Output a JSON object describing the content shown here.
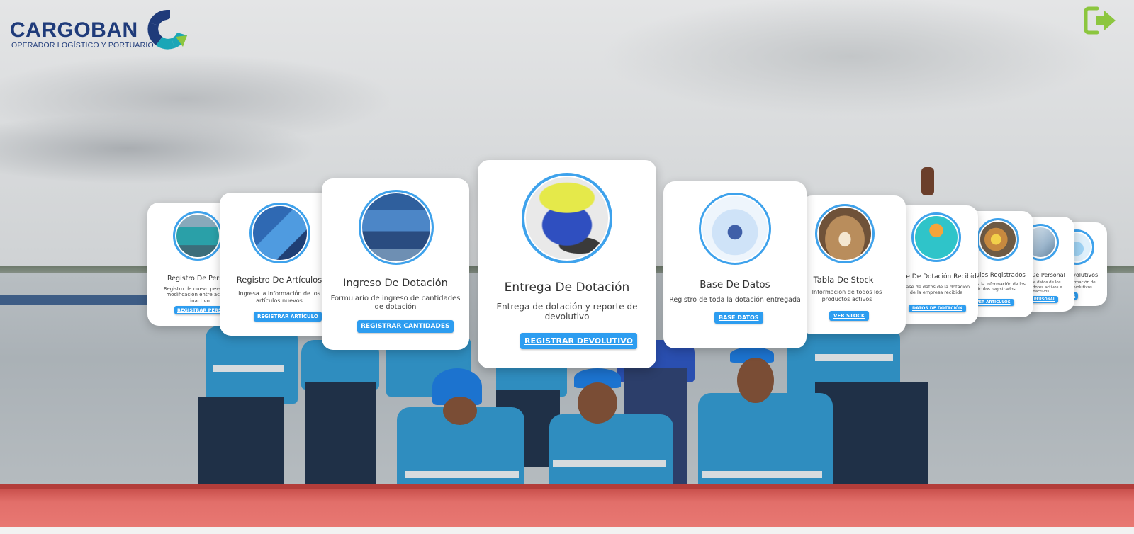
{
  "brand": {
    "name": "CARGOBAN",
    "tagline": "OPERADOR LOGÍSTICO Y PORTUARIO",
    "colors": {
      "navy": "#1f3b7a",
      "teal": "#1aa6b7",
      "blue": "#2d9df0",
      "green": "#8cc63f"
    }
  },
  "header": {
    "logout_icon": "logout-icon"
  },
  "cards": {
    "registro_personal": {
      "title": "Registro De Personal",
      "description": "Registro de nuevo personal y modificación entre activo e inactivo",
      "button": "REGISTRAR PERSONAL",
      "icon": "workers-photo"
    },
    "registro_articulos": {
      "title": "Registro De Artículos",
      "description": "Ingresa la información de los artículos nuevos",
      "button": "REGISTRAR ARTÍCULO",
      "icon": "warehouse-shelves-photo"
    },
    "ingreso_dotacion": {
      "title": "Ingreso De Dotación",
      "description": "Formulario de ingreso de cantidades de dotación",
      "button": "REGISTRAR CANTIDADES",
      "icon": "stock-shelves-photo"
    },
    "entrega_dotacion": {
      "title": "Entrega De Dotación",
      "description": "Entrega de dotación y reporte de devolutivo",
      "button": "REGISTRAR DEVOLUTIVO",
      "icon": "vest-and-boots-photo"
    },
    "base_datos": {
      "title": "Base De Datos",
      "description": "Registro de toda la dotación entregada",
      "button": "BASE DATOS",
      "icon": "developer-illustration"
    },
    "tabla_stock": {
      "title": "Tabla De Stock",
      "description": "Información de todos los productos activos",
      "button": "VER STOCK",
      "icon": "warehouse-aisle-photo"
    },
    "dotacion_recibida": {
      "title": "Base De Dotación Recibida",
      "description": "Base de datos de la dotación de la empresa recibida",
      "button": "DATOS DE DOTACIÓN",
      "icon": "worker-helmet-illustration"
    },
    "articulos_registrados": {
      "title": "Artículos Registrados",
      "description": "Ver toda la información de los artículos registrados",
      "button": "VER ARTÍCULOS",
      "icon": "warehouse-worker-photo"
    },
    "base_personal": {
      "title": "Base De Personal",
      "description": "Base de datos de los trabajadores activos e inactivos",
      "button": "VER PERSONAL",
      "icon": "office-photo"
    },
    "devolutivos": {
      "title": "Devolutivos",
      "description": "Información de devolutivos",
      "button": "VER",
      "icon": "users-illustration"
    }
  }
}
